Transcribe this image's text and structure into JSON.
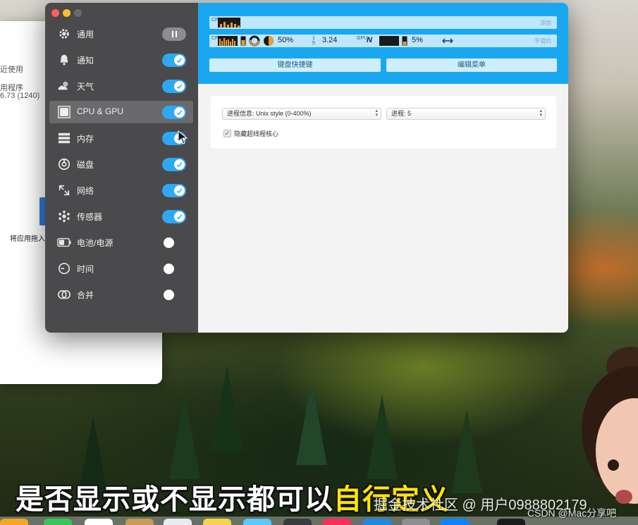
{
  "background_window": {
    "rows": [
      "近使用",
      "用程序",
      "6.73 (1240)"
    ],
    "install_label": "将应用拖入"
  },
  "sidebar": {
    "items": [
      {
        "label": "通用",
        "icon": "gear-icon",
        "toggle": "pause"
      },
      {
        "label": "通知",
        "icon": "bell-icon",
        "toggle": "on"
      },
      {
        "label": "天气",
        "icon": "weather-icon",
        "toggle": "on"
      },
      {
        "label": "CPU & GPU",
        "icon": "cpu-icon",
        "toggle": "on",
        "selected": true
      },
      {
        "label": "内存",
        "icon": "memory-icon",
        "toggle": "on"
      },
      {
        "label": "磁盘",
        "icon": "disk-icon",
        "toggle": "on"
      },
      {
        "label": "网络",
        "icon": "network-icon",
        "toggle": "on"
      },
      {
        "label": "传感器",
        "icon": "sensor-icon",
        "toggle": "on"
      },
      {
        "label": "电池/电源",
        "icon": "battery-icon",
        "toggle": "off"
      },
      {
        "label": "时间",
        "icon": "clock-icon",
        "toggle": "off"
      },
      {
        "label": "合并",
        "icon": "merge-icon",
        "toggle": "off"
      }
    ]
  },
  "header": {
    "strip1": {
      "vertical_label": "CPU",
      "right_label": "添加"
    },
    "strip2": {
      "cpu_percent": "50%",
      "load_label": "1 5",
      "load_value": "3.24",
      "gpu_label": "GPU",
      "gpu_n": "N",
      "gpu_percent": "5%",
      "right_label": "平滑的"
    },
    "keyboard_shortcut_button": "键盘快捷键",
    "edit_menu_button": "编辑菜单"
  },
  "settings": {
    "process_info_select": "进程信息: Unix style (0-400%)",
    "process_count_select": "进程:  5",
    "hide_hyperthreading_label": "隐藏超线程核心",
    "hide_hyperthreading_checked": true
  },
  "overlay": {
    "caption_white": "是否显示或不显示都可以",
    "caption_yellow": "自行定义",
    "watermark": "掘金技术社区 @ 用户0988802179",
    "csdn": "CSDN @Mac分享吧"
  },
  "colors": {
    "accent_blue": "#19a8f0",
    "toggle_on": "#2ea8f2",
    "sidebar_bg": "#4a4a4c",
    "caption_highlight": "#ffe600"
  }
}
